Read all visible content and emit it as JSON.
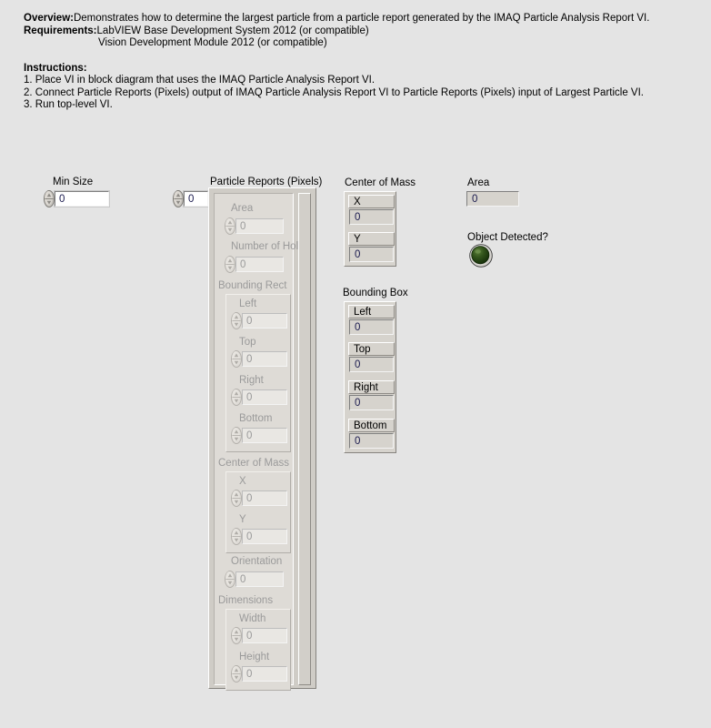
{
  "window": {
    "background_color": "#e4e4e4"
  },
  "documentation": {
    "overview_label": "Overview:",
    "overview_text": "Demonstrates how to determine the largest particle from a particle report generated by the IMAQ Particle Analysis Report VI.",
    "requirements_label": "Requirements:",
    "requirements_text": "LabVIEW Base Development System 2012 (or compatible)",
    "requirements_text2": "Vision Development Module 2012 (or compatible)",
    "instructions_label": "Instructions:",
    "instructions": [
      "1. Place VI in block diagram that uses the IMAQ Particle Analysis Report VI.",
      "2. Connect Particle Reports (Pixels) output of IMAQ Particle Analysis Report VI to Particle Reports (Pixels) input of Largest Particle VI.",
      "3. Run top-level VI."
    ]
  },
  "min_size": {
    "label": "Min Size",
    "value": "0",
    "spinner_icon": "spinner-up-down-icon"
  },
  "particle_reports": {
    "label": "Particle Reports (Pixels)",
    "index_value": "0",
    "index_spinner_icon": "spinner-up-down-icon",
    "fields": [
      {
        "label": "Area",
        "value": "0"
      },
      {
        "label": "Number of Holes",
        "value": "0"
      }
    ],
    "bounding_rect": {
      "label": "Bounding Rect",
      "fields": [
        {
          "label": "Left",
          "value": "0"
        },
        {
          "label": "Top",
          "value": "0"
        },
        {
          "label": "Right",
          "value": "0"
        },
        {
          "label": "Bottom",
          "value": "0"
        }
      ]
    },
    "center_of_mass": {
      "label": "Center of Mass",
      "fields": [
        {
          "label": "X",
          "value": "0"
        },
        {
          "label": "Y",
          "value": "0"
        }
      ]
    },
    "orientation": {
      "label": "Orientation",
      "value": "0"
    },
    "dimensions": {
      "label": "Dimensions",
      "fields": [
        {
          "label": "Width",
          "value": "0"
        },
        {
          "label": "Height",
          "value": "0"
        }
      ]
    }
  },
  "center_of_mass_out": {
    "label": "Center of Mass",
    "fields": [
      {
        "label": "X",
        "value": "0"
      },
      {
        "label": "Y",
        "value": "0"
      }
    ]
  },
  "bounding_box_out": {
    "label": "Bounding Box",
    "fields": [
      {
        "label": "Left",
        "value": "0"
      },
      {
        "label": "Top",
        "value": "0"
      },
      {
        "label": "Right",
        "value": "0"
      },
      {
        "label": "Bottom",
        "value": "0"
      }
    ]
  },
  "area_out": {
    "label": "Area",
    "value": "0"
  },
  "object_detected": {
    "label": "Object Detected?",
    "state": "off",
    "led_icon": "round-led-icon",
    "off_color": "#2d5016",
    "on_color": "#3fbf3f"
  }
}
